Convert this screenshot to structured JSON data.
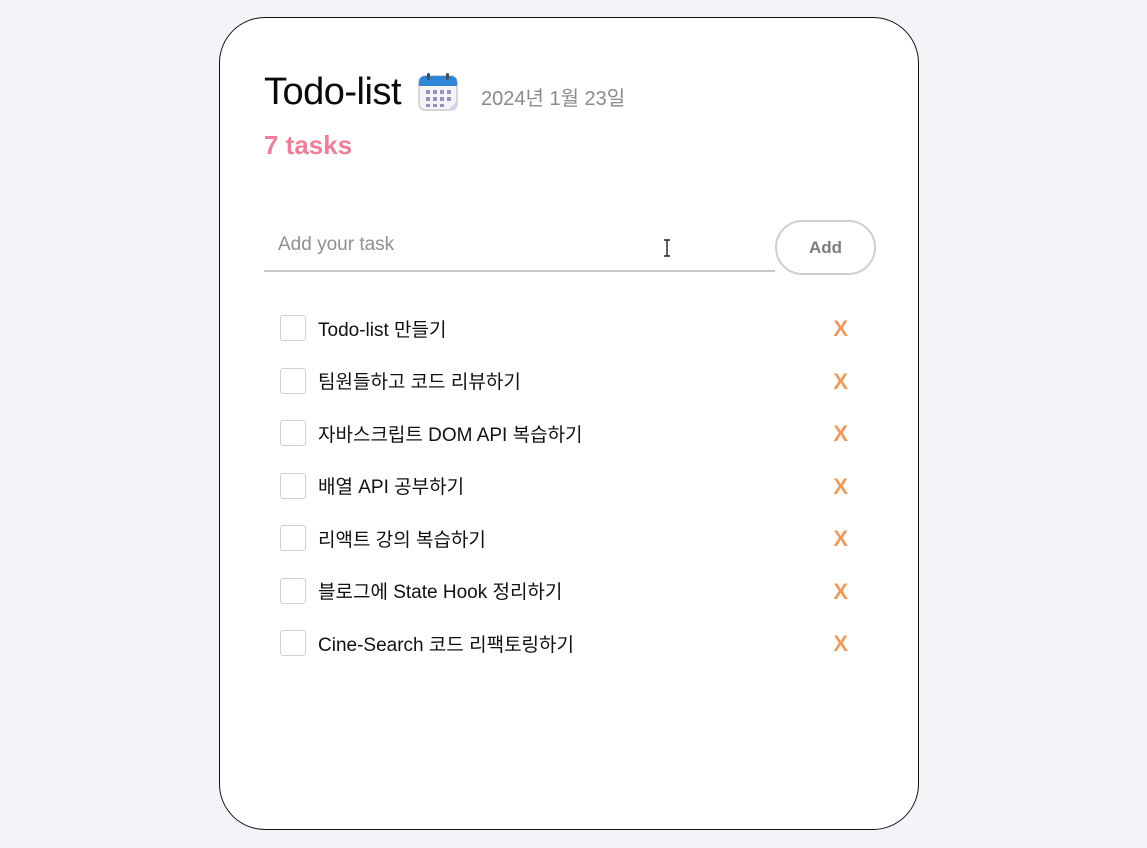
{
  "header": {
    "title": "Todo-list",
    "date": "2024년 1월 23일",
    "calendar_icon": "calendar-icon"
  },
  "task_count": "7 tasks",
  "input": {
    "placeholder": "Add your task",
    "value": "",
    "add_label": "Add"
  },
  "tasks": [
    {
      "text": "Todo-list 만들기",
      "done": false,
      "delete_label": "X"
    },
    {
      "text": "팀원들하고 코드 리뷰하기",
      "done": false,
      "delete_label": "X"
    },
    {
      "text": "자바스크립트 DOM API 복습하기",
      "done": false,
      "delete_label": "X"
    },
    {
      "text": "배열 API 공부하기",
      "done": false,
      "delete_label": "X"
    },
    {
      "text": "리액트 강의 복습하기",
      "done": false,
      "delete_label": "X"
    },
    {
      "text": "블로그에 State Hook 정리하기",
      "done": false,
      "delete_label": "X"
    },
    {
      "text": "Cine-Search 코드 리팩토링하기",
      "done": false,
      "delete_label": "X"
    }
  ],
  "colors": {
    "background": "#f3f4f8",
    "count_accent": "#ef7f98",
    "delete_accent": "#ee9a5d"
  }
}
